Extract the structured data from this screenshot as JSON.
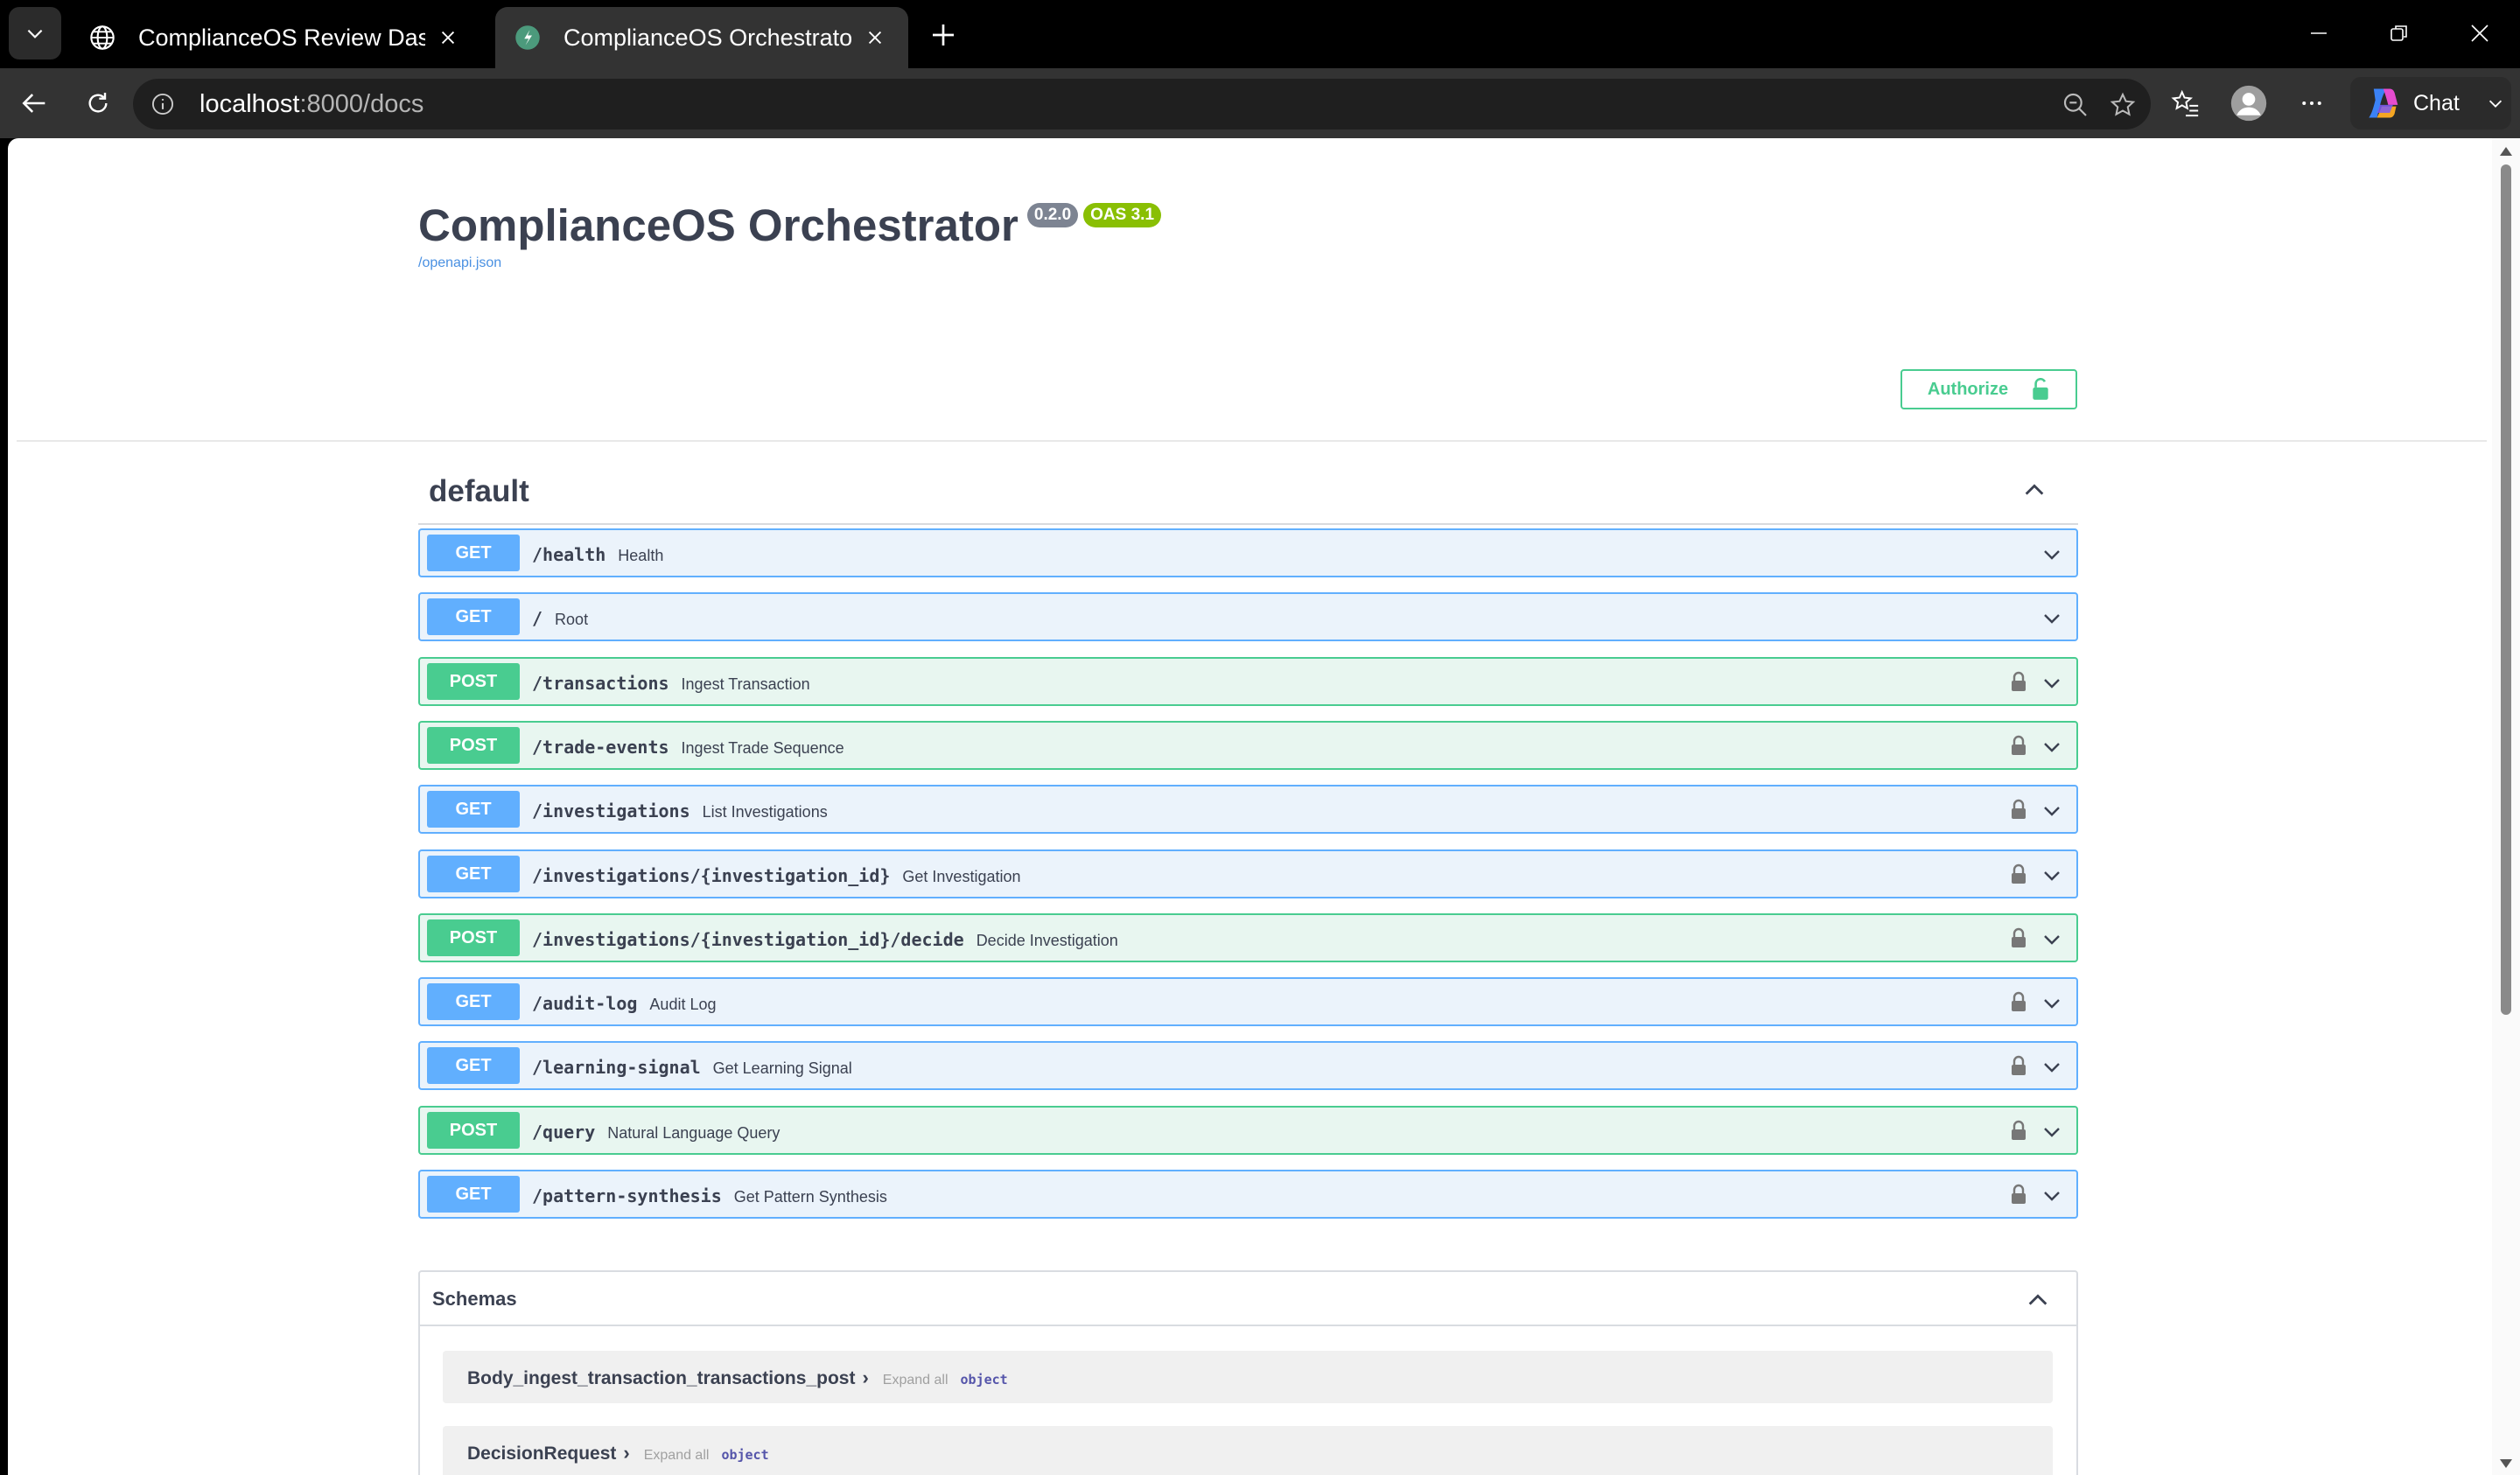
{
  "browser": {
    "tabs": [
      {
        "title": "ComplianceOS Review Dashboard",
        "active": false
      },
      {
        "title": "ComplianceOS Orchestrator - Swagger UI",
        "active": true
      }
    ],
    "url_host": "localhost",
    "url_rest": ":8000/docs",
    "chat_label": "Chat"
  },
  "info": {
    "title": "ComplianceOS Orchestrator",
    "version": "0.2.0",
    "oas": "OAS 3.1",
    "spec_link": "/openapi.json"
  },
  "authorize_label": "Authorize",
  "tag": {
    "name": "default"
  },
  "operations": [
    {
      "method": "GET",
      "path": "/health",
      "summary": "Health",
      "locked": false
    },
    {
      "method": "GET",
      "path": "/",
      "summary": "Root",
      "locked": false
    },
    {
      "method": "POST",
      "path": "/transactions",
      "summary": "Ingest Transaction",
      "locked": true
    },
    {
      "method": "POST",
      "path": "/trade-events",
      "summary": "Ingest Trade Sequence",
      "locked": true
    },
    {
      "method": "GET",
      "path": "/investigations",
      "summary": "List Investigations",
      "locked": true
    },
    {
      "method": "GET",
      "path": "/investigations/{investigation_id}",
      "summary": "Get Investigation",
      "locked": true
    },
    {
      "method": "POST",
      "path": "/investigations/{investigation_id}/decide",
      "summary": "Decide Investigation",
      "locked": true
    },
    {
      "method": "GET",
      "path": "/audit-log",
      "summary": "Audit Log",
      "locked": true
    },
    {
      "method": "GET",
      "path": "/learning-signal",
      "summary": "Get Learning Signal",
      "locked": true
    },
    {
      "method": "POST",
      "path": "/query",
      "summary": "Natural Language Query",
      "locked": true
    },
    {
      "method": "GET",
      "path": "/pattern-synthesis",
      "summary": "Get Pattern Synthesis",
      "locked": true
    }
  ],
  "schemas": {
    "title": "Schemas",
    "models": [
      {
        "name": "Body_ingest_transaction_transactions_post",
        "expand": "Expand all",
        "type": "object"
      },
      {
        "name": "DecisionRequest",
        "expand": "Expand all",
        "type": "object"
      }
    ]
  },
  "colors": {
    "get": "#61affe",
    "post": "#49cc90",
    "get_bg": "#ebf3fb",
    "post_bg": "#e8f6f0",
    "version_badge": "#7d8492",
    "oas_badge": "#89bf04"
  }
}
